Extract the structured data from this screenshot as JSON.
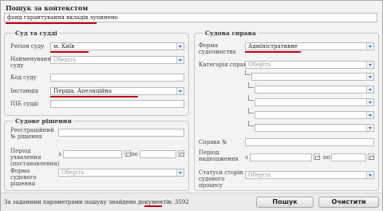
{
  "search": {
    "context_label": "Пошук за контекстом",
    "context_value": "фонд гарантування вкладів зупинено"
  },
  "court": {
    "legend": "Суд та судді",
    "region_label": "Регіон суду",
    "region_value": "м. Київ",
    "court_name_label": "Найменування суду",
    "court_name_placeholder": "Оберіть",
    "court_code_label": "Код суду",
    "instance_label": "Інстанція",
    "instance_value": "Перша, Апеляційна",
    "judge_label": "ПІБ судді"
  },
  "decision": {
    "legend": "Судове рішення",
    "reg_number_label": "Реєстраційний № рішення",
    "period_label": "Період ухвалення (постановлення)",
    "from_label": "з",
    "to_label": "по",
    "form_label": "Форма судового рішення",
    "form_placeholder": "Оберіть"
  },
  "case": {
    "legend": "Судова справа",
    "jurisdiction_label": "Форма судочинства",
    "jurisdiction_value": "Адміністративне",
    "category_label": "Категорія справи",
    "category_placeholder": "Оберіть",
    "case_number_label": "Справа №",
    "received_label": "Період надходження",
    "from_label": "з",
    "to_label": "по",
    "party_status_label": "Статуси сторін судового процесу",
    "party_status_placeholder": "Оберіть"
  },
  "footer": {
    "result_text": "За заданими параметрами пошуку знайдено документів:",
    "result_count": "3592",
    "search_button": "Пошук",
    "clear_button": "Очистити"
  },
  "colors": {
    "highlight": "#c0001a",
    "background": "#f3f3f3",
    "arrow": "#4a6fa5"
  }
}
